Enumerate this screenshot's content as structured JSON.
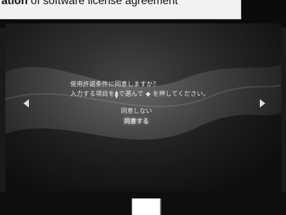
{
  "caption": {
    "bold": "ation",
    "rest": "of software license agreement"
  },
  "dialog": {
    "line1": "使用許諾条件に同意しますか？",
    "line2_prefix": "入力する項目を",
    "line2_middle": "で選んで",
    "line2_suffix": "を押してください。"
  },
  "options": [
    {
      "label": "同意しない",
      "selected": false
    },
    {
      "label": "同意する",
      "selected": true
    }
  ],
  "icons": {
    "up_down": "up-down-dpad-icon",
    "confirm": "diamond-button-icon",
    "left": "left-arrow-icon",
    "right": "right-arrow-icon"
  },
  "colors": {
    "text": "#e8e8e8",
    "selected_glow": "#ffffff",
    "background_dark": "#1a1a1a"
  }
}
